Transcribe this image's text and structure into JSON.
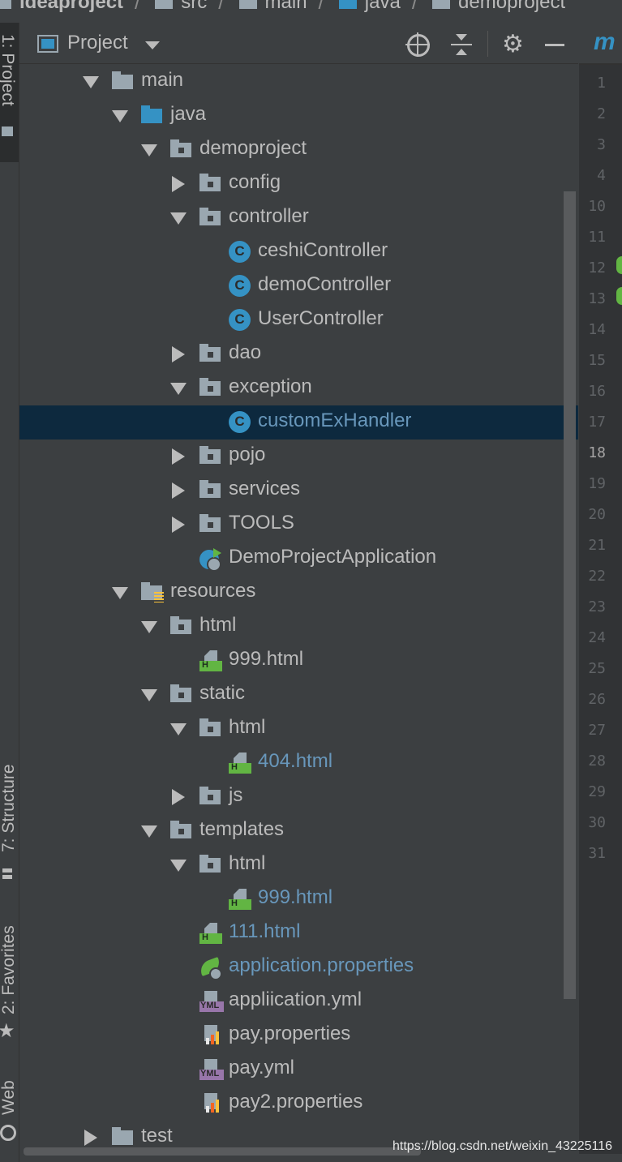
{
  "breadcrumb": {
    "items": [
      "ideaproject",
      "src",
      "main",
      "java",
      "demoproject"
    ]
  },
  "side_tabs": {
    "project": "1: Project",
    "structure": "7: Structure",
    "favorites": "2: Favorites",
    "web": "Web"
  },
  "panel": {
    "title": "Project",
    "icons": [
      "locate-icon",
      "collapse-all-icon",
      "gear-icon",
      "hide-icon"
    ]
  },
  "editor": {
    "tab_letter": "m",
    "current_line": "18",
    "line_numbers": [
      "1",
      "2",
      "3",
      "4",
      "10",
      "11",
      "12",
      "13",
      "14",
      "15",
      "16",
      "17",
      "18",
      "19",
      "20",
      "21",
      "22",
      "23",
      "24",
      "25",
      "26",
      "27",
      "28",
      "29",
      "30",
      "31"
    ]
  },
  "tree": [
    {
      "label": "main",
      "depth": 0,
      "arrow": "down",
      "icon": "folder"
    },
    {
      "label": "java",
      "depth": 1,
      "arrow": "down",
      "icon": "folder-blue"
    },
    {
      "label": "demoproject",
      "depth": 2,
      "arrow": "down",
      "icon": "package"
    },
    {
      "label": "config",
      "depth": 3,
      "arrow": "right",
      "icon": "package"
    },
    {
      "label": "controller",
      "depth": 3,
      "arrow": "down",
      "icon": "package"
    },
    {
      "label": "ceshiController",
      "depth": 4,
      "arrow": "",
      "icon": "class"
    },
    {
      "label": "demoController",
      "depth": 4,
      "arrow": "",
      "icon": "class"
    },
    {
      "label": "UserController",
      "depth": 4,
      "arrow": "",
      "icon": "class"
    },
    {
      "label": "dao",
      "depth": 3,
      "arrow": "right",
      "icon": "package"
    },
    {
      "label": "exception",
      "depth": 3,
      "arrow": "down",
      "icon": "package"
    },
    {
      "label": "customExHandler",
      "depth": 4,
      "arrow": "",
      "icon": "class",
      "selected": true,
      "color": "blue"
    },
    {
      "label": "pojo",
      "depth": 3,
      "arrow": "right",
      "icon": "package"
    },
    {
      "label": "services",
      "depth": 3,
      "arrow": "right",
      "icon": "package"
    },
    {
      "label": "TOOLS",
      "depth": 3,
      "arrow": "right",
      "icon": "package"
    },
    {
      "label": "DemoProjectApplication",
      "depth": 3,
      "arrow": "",
      "icon": "spring-app"
    },
    {
      "label": "resources",
      "depth": 1,
      "arrow": "down",
      "icon": "resources"
    },
    {
      "label": "html",
      "depth": 2,
      "arrow": "down",
      "icon": "package"
    },
    {
      "label": "999.html",
      "depth": 3,
      "arrow": "",
      "icon": "html"
    },
    {
      "label": "static",
      "depth": 2,
      "arrow": "down",
      "icon": "package"
    },
    {
      "label": "html",
      "depth": 3,
      "arrow": "down",
      "icon": "package"
    },
    {
      "label": "404.html",
      "depth": 4,
      "arrow": "",
      "icon": "html",
      "color": "blue"
    },
    {
      "label": "js",
      "depth": 3,
      "arrow": "right",
      "icon": "package"
    },
    {
      "label": "templates",
      "depth": 2,
      "arrow": "down",
      "icon": "package"
    },
    {
      "label": "html",
      "depth": 3,
      "arrow": "down",
      "icon": "package"
    },
    {
      "label": "999.html",
      "depth": 4,
      "arrow": "",
      "icon": "html",
      "color": "blue"
    },
    {
      "label": "111.html",
      "depth": 3,
      "arrow": "",
      "icon": "html",
      "color": "blue"
    },
    {
      "label": "application.properties",
      "depth": 3,
      "arrow": "",
      "icon": "spring-prop",
      "color": "blue"
    },
    {
      "label": "appliication.yml",
      "depth": 3,
      "arrow": "",
      "icon": "yml"
    },
    {
      "label": "pay.properties",
      "depth": 3,
      "arrow": "",
      "icon": "properties"
    },
    {
      "label": "pay.yml",
      "depth": 3,
      "arrow": "",
      "icon": "yml"
    },
    {
      "label": "pay2.properties",
      "depth": 3,
      "arrow": "",
      "icon": "properties"
    },
    {
      "label": "test",
      "depth": 0,
      "arrow": "right",
      "icon": "folder"
    }
  ],
  "watermark": "https://blog.csdn.net/weixin_43225116",
  "colors": {
    "background": "#3c3f41",
    "selection": "#0d293e",
    "accent_blue": "#3592c4",
    "link_text": "#6897bb",
    "html_green": "#62b543"
  }
}
